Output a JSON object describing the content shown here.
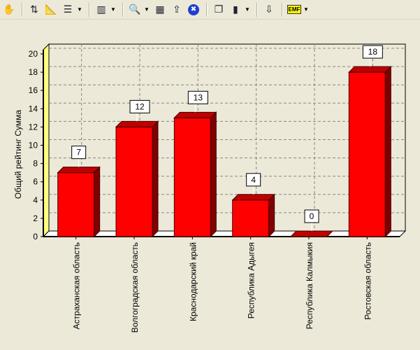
{
  "toolbar": {
    "buttons": [
      {
        "icon": "hand-icon"
      },
      {
        "icon": "axis-settings-icon"
      },
      {
        "icon": "ruler-icon"
      },
      {
        "icon": "legend-icon",
        "dropdown": true
      },
      {
        "icon": "chart-type-icon",
        "dropdown": true
      },
      {
        "icon": "zoom-icon",
        "dropdown": true
      },
      {
        "icon": "grid-pivot-icon"
      },
      {
        "icon": "sort-icon"
      },
      {
        "icon": "close-circle-icon"
      },
      {
        "icon": "copy-icon"
      },
      {
        "icon": "bar-colors-icon",
        "dropdown": true
      },
      {
        "icon": "export-icon"
      },
      {
        "icon": "emf-icon",
        "label": "EMF",
        "dropdown": true
      }
    ]
  },
  "chart_data": {
    "type": "bar",
    "title": "",
    "xlabel": "",
    "ylabel": "Общий рейтинг Сумма",
    "categories": [
      "Астраханская область",
      "Волгоградская область",
      "Краснодарский край",
      "Республика Адыгея",
      "Республика Калмыкия",
      "Ростовская область"
    ],
    "values": [
      7,
      12,
      13,
      4,
      0,
      18
    ],
    "ylim": [
      0,
      20
    ],
    "yticks": [
      "0",
      "2",
      "4",
      "6",
      "8",
      "10",
      "12",
      "14",
      "16",
      "18",
      "20"
    ],
    "grid": true,
    "bar_color": "#ff0000",
    "wall_color": "#ffff80"
  }
}
